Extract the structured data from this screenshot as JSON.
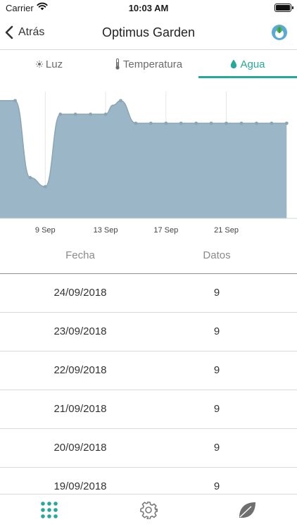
{
  "status_bar": {
    "carrier": "Carrier",
    "time": "10:03 AM"
  },
  "nav": {
    "back_label": "Atrás",
    "title": "Optimus Garden"
  },
  "tabs": [
    {
      "label": "Luz",
      "icon": "sun-icon",
      "active": false
    },
    {
      "label": "Temperatura",
      "icon": "thermometer-icon",
      "active": false
    },
    {
      "label": "Agua",
      "icon": "water-drop-icon",
      "active": true
    }
  ],
  "colors": {
    "accent": "#26a89a",
    "chart_fill": "#9bb6c6",
    "chart_line": "#8aa6b5"
  },
  "chart_data": {
    "type": "area",
    "x_tick_labels": [
      "9 Sep",
      "13 Sep",
      "17 Sep",
      "21 Sep"
    ],
    "x_ticks": [
      9,
      13,
      17,
      21
    ],
    "xlim": [
      6,
      25.5
    ],
    "ylim": [
      0,
      14
    ],
    "grid": true,
    "series": [
      {
        "x": [
          6,
          7,
          8,
          9,
          10,
          11,
          12,
          13,
          13.5,
          14,
          15,
          16,
          17,
          18,
          19,
          20,
          21,
          22,
          23,
          24,
          25
        ],
        "values": [
          13,
          13,
          4.5,
          3.5,
          11.5,
          11.5,
          11.5,
          11.5,
          12.5,
          13,
          10.5,
          10.5,
          10.5,
          10.5,
          10.5,
          10.5,
          10.5,
          10.5,
          10.5,
          10.5,
          10.5
        ]
      }
    ]
  },
  "table": {
    "headers": {
      "date": "Fecha",
      "data": "Datos"
    },
    "rows": [
      {
        "date": "24/09/2018",
        "value": "9"
      },
      {
        "date": "23/09/2018",
        "value": "9"
      },
      {
        "date": "22/09/2018",
        "value": "9"
      },
      {
        "date": "21/09/2018",
        "value": "9"
      },
      {
        "date": "20/09/2018",
        "value": "9"
      },
      {
        "date": "19/09/2018",
        "value": "9"
      }
    ]
  },
  "tab_bar": [
    {
      "icon": "grid-icon",
      "active": true
    },
    {
      "icon": "gear-icon",
      "active": false
    },
    {
      "icon": "leaf-icon",
      "active": false
    }
  ]
}
